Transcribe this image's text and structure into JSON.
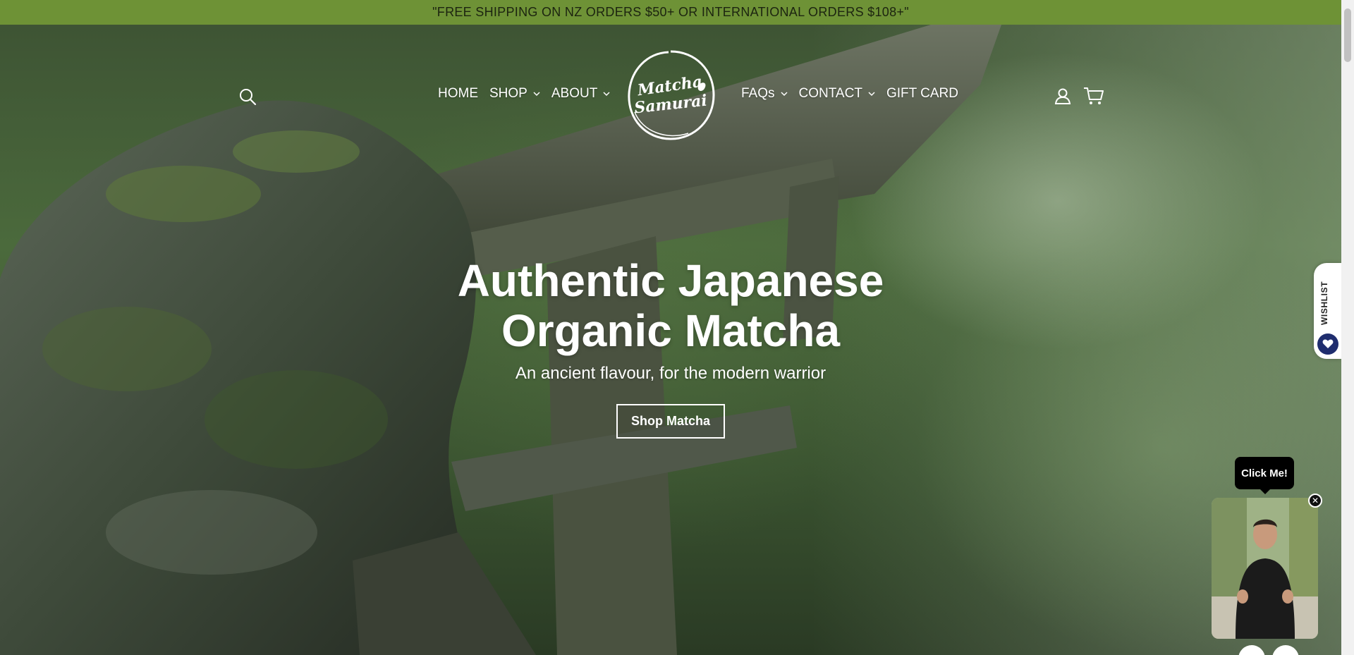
{
  "announcement": {
    "text": "\"FREE SHIPPING ON NZ ORDERS $50+ OR INTERNATIONAL ORDERS $108+\""
  },
  "header": {
    "left_nav": [
      {
        "label": "HOME",
        "has_dropdown": false
      },
      {
        "label": "SHOP",
        "has_dropdown": true
      },
      {
        "label": "ABOUT",
        "has_dropdown": true
      }
    ],
    "right_nav": [
      {
        "label": "FAQs",
        "has_dropdown": true
      },
      {
        "label": "CONTACT",
        "has_dropdown": true
      },
      {
        "label": "GIFT CARD",
        "has_dropdown": false
      }
    ],
    "logo": {
      "line1": "Matcha",
      "line2": "Samurai"
    },
    "icons": [
      "search-icon",
      "account-icon",
      "cart-icon"
    ]
  },
  "hero": {
    "title_line1": "Authentic Japanese",
    "title_line2": "Organic Matcha",
    "subtitle": "An ancient flavour, for the modern warrior",
    "cta_label": "Shop Matcha"
  },
  "wishlist": {
    "label": "WISHLIST",
    "icon": "heart-icon"
  },
  "video_widget": {
    "prompt": "Click Me!",
    "close_icon": "close-icon"
  },
  "colors": {
    "announcement_bg": "#6e9236",
    "wishlist_heart_bg": "#1f2d6e"
  }
}
